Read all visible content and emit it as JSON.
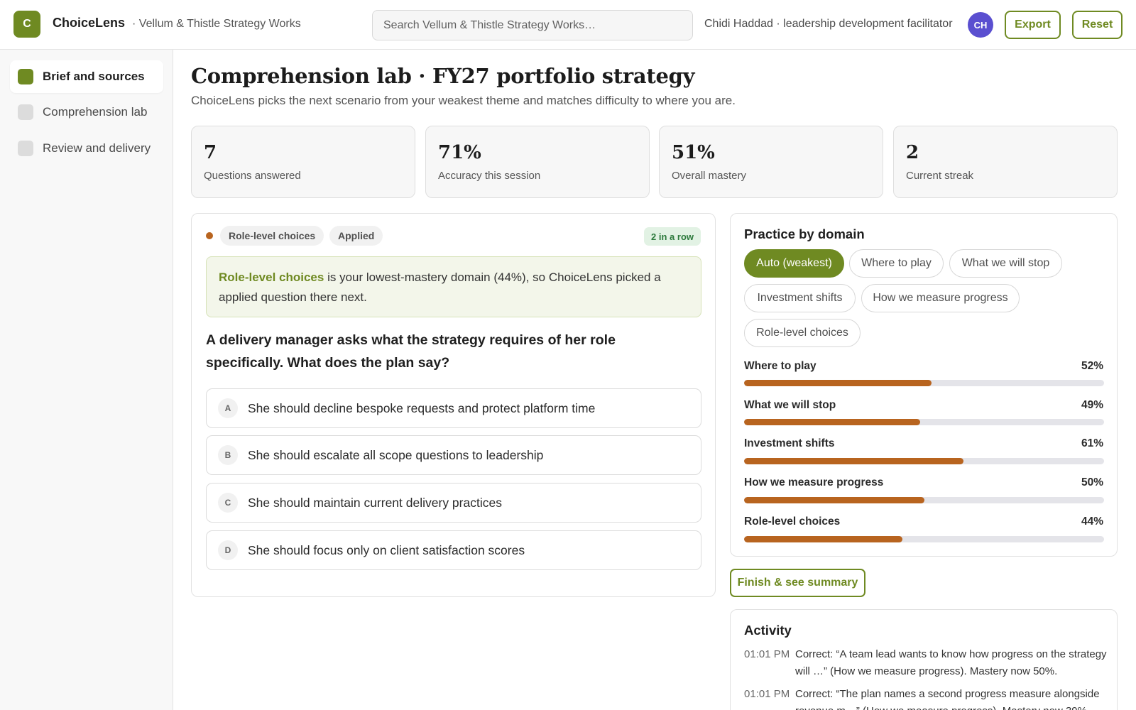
{
  "header": {
    "logo_letter": "C",
    "app_name": "ChoiceLens",
    "org": "· Vellum & Thistle Strategy Works",
    "search_placeholder": "Search Vellum & Thistle Strategy Works…",
    "user": "Chidi Haddad · leadership development facilitator",
    "avatar_initials": "CH",
    "export_label": "Export",
    "reset_label": "Reset"
  },
  "sidebar": {
    "items": [
      {
        "label": "Brief and sources",
        "active": true
      },
      {
        "label": "Comprehension lab",
        "active": false
      },
      {
        "label": "Review and delivery",
        "active": false
      }
    ]
  },
  "main": {
    "title": "Comprehension lab · FY27 portfolio strategy",
    "subtitle": "ChoiceLens picks the next scenario from your weakest theme and matches difficulty to where you are."
  },
  "stats": [
    {
      "value": "7",
      "label": "Questions answered"
    },
    {
      "value": "71%",
      "label": "Accuracy this session"
    },
    {
      "value": "51%",
      "label": "Overall mastery"
    },
    {
      "value": "2",
      "label": "Current streak"
    }
  ],
  "question_card": {
    "domain_tag": "Role-level choices",
    "level_tag": "Applied",
    "streak_badge": "2 in a row",
    "explain_highlight": "Role-level choices",
    "explain_rest": " is your lowest-mastery domain (44%), so ChoiceLens picked a applied question there next.",
    "question": "A delivery manager asks what the strategy requires of her role specifically. What does the plan say?",
    "options": [
      {
        "letter": "A",
        "text": "She should decline bespoke requests and protect platform time"
      },
      {
        "letter": "B",
        "text": "She should escalate all scope questions to leadership"
      },
      {
        "letter": "C",
        "text": "She should maintain current delivery practices"
      },
      {
        "letter": "D",
        "text": "She should focus only on client satisfaction scores"
      }
    ]
  },
  "practice": {
    "title": "Practice by domain",
    "chips": [
      {
        "label": "Auto (weakest)",
        "active": true
      },
      {
        "label": "Where to play",
        "active": false
      },
      {
        "label": "What we will stop",
        "active": false
      },
      {
        "label": "Investment shifts",
        "active": false
      },
      {
        "label": "How we measure progress",
        "active": false
      },
      {
        "label": "Role-level choices",
        "active": false
      }
    ],
    "domains": [
      {
        "name": "Where to play",
        "pct_label": "52%",
        "pct": 52
      },
      {
        "name": "What we will stop",
        "pct_label": "49%",
        "pct": 49
      },
      {
        "name": "Investment shifts",
        "pct_label": "61%",
        "pct": 61
      },
      {
        "name": "How we measure progress",
        "pct_label": "50%",
        "pct": 50
      },
      {
        "name": "Role-level choices",
        "pct_label": "44%",
        "pct": 44
      }
    ],
    "bar_color": "#b8641f"
  },
  "finish_label": "Finish & see summary",
  "activity": {
    "title": "Activity",
    "entries": [
      {
        "time": "01:01 PM",
        "text": "Correct: “A team lead wants to know how progress on the strategy will …” (How we measure progress). Mastery now 50%."
      },
      {
        "time": "01:01 PM",
        "text": "Correct: “The plan names a second progress measure alongside revenue m…” (How we measure progress). Mastery now 39%."
      }
    ]
  },
  "colors": {
    "accent": "#6f8a22",
    "bar": "#b8641f",
    "avatar": "#5a4fd0"
  }
}
